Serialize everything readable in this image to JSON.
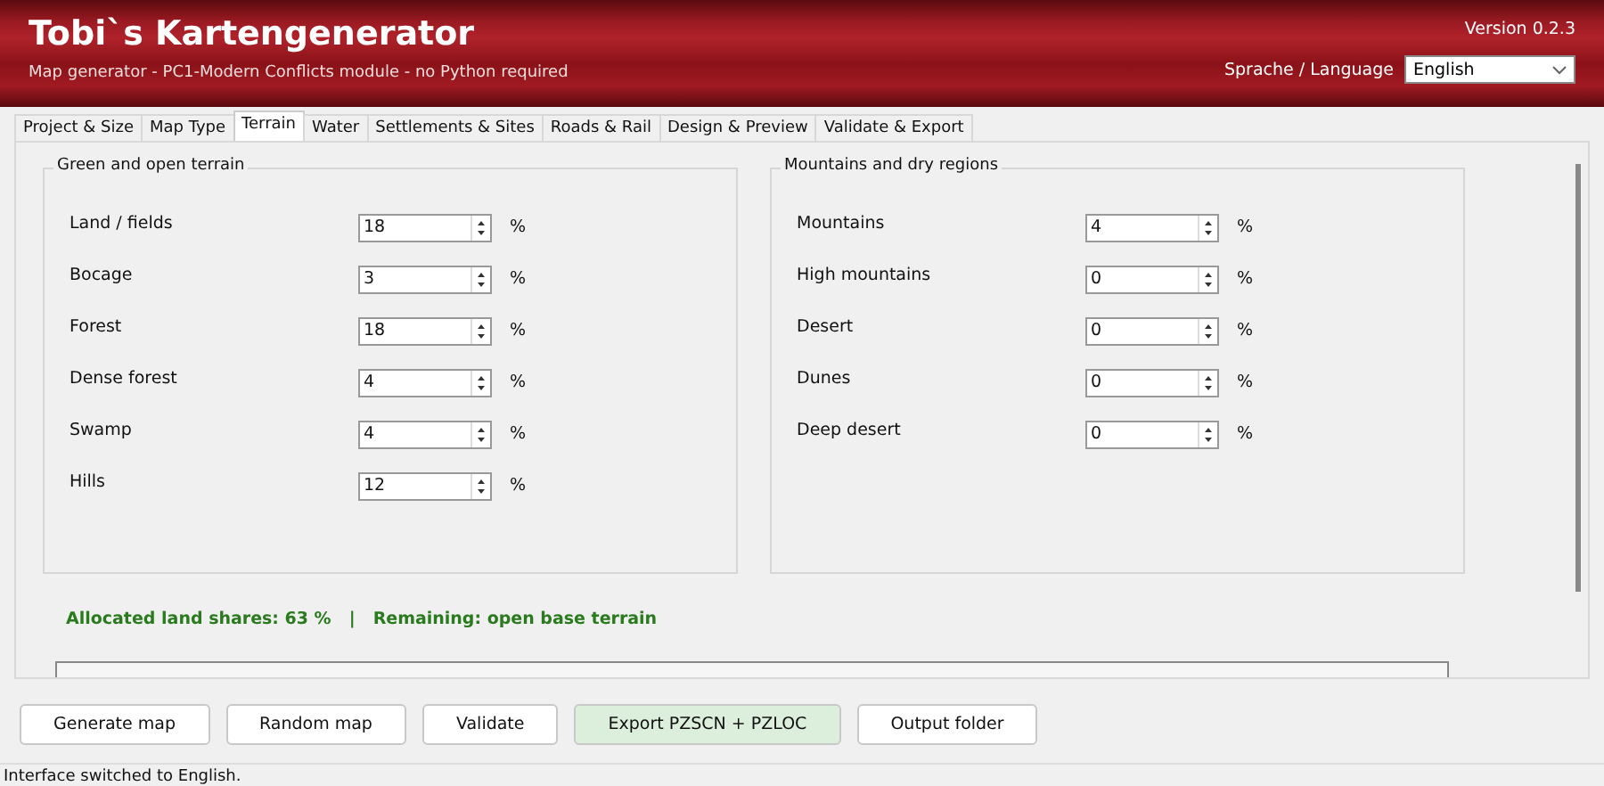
{
  "header": {
    "title": "Tobi`s Kartengenerator",
    "subtitle": "Map generator - PC1-Modern Conflicts module - no Python required",
    "version": "Version 0.2.3",
    "language_label": "Sprache / Language",
    "language_value": "English"
  },
  "tabs": [
    {
      "label": "Project & Size",
      "selected": false
    },
    {
      "label": "Map Type",
      "selected": false
    },
    {
      "label": "Terrain",
      "selected": true
    },
    {
      "label": "Water",
      "selected": false
    },
    {
      "label": "Settlements & Sites",
      "selected": false
    },
    {
      "label": "Roads & Rail",
      "selected": false
    },
    {
      "label": "Design & Preview",
      "selected": false
    },
    {
      "label": "Validate & Export",
      "selected": false
    }
  ],
  "groups": [
    {
      "title": "Green and open terrain",
      "rows": [
        {
          "label": "Land / fields",
          "value": "18",
          "unit": "%"
        },
        {
          "label": "Bocage",
          "value": "3",
          "unit": "%"
        },
        {
          "label": "Forest",
          "value": "18",
          "unit": "%"
        },
        {
          "label": "Dense forest",
          "value": "4",
          "unit": "%"
        },
        {
          "label": "Swamp",
          "value": "4",
          "unit": "%"
        },
        {
          "label": "Hills",
          "value": "12",
          "unit": "%"
        }
      ]
    },
    {
      "title": "Mountains and dry regions",
      "rows": [
        {
          "label": "Mountains",
          "value": "4",
          "unit": "%"
        },
        {
          "label": "High mountains",
          "value": "0",
          "unit": "%"
        },
        {
          "label": "Desert",
          "value": "0",
          "unit": "%"
        },
        {
          "label": "Dunes",
          "value": "0",
          "unit": "%"
        },
        {
          "label": "Deep desert",
          "value": "0",
          "unit": "%"
        }
      ]
    }
  ],
  "summary": {
    "allocated": "Allocated land shares: 63 %",
    "separator": "|",
    "remaining": "Remaining: open base terrain"
  },
  "buttons": [
    {
      "label": "Generate map",
      "kind": "normal"
    },
    {
      "label": "Random map",
      "kind": "normal"
    },
    {
      "label": "Validate",
      "kind": "normal"
    },
    {
      "label": "Export PZSCN + PZLOC",
      "kind": "primary"
    },
    {
      "label": "Output folder",
      "kind": "normal"
    }
  ],
  "status_bar": "Interface switched to English."
}
